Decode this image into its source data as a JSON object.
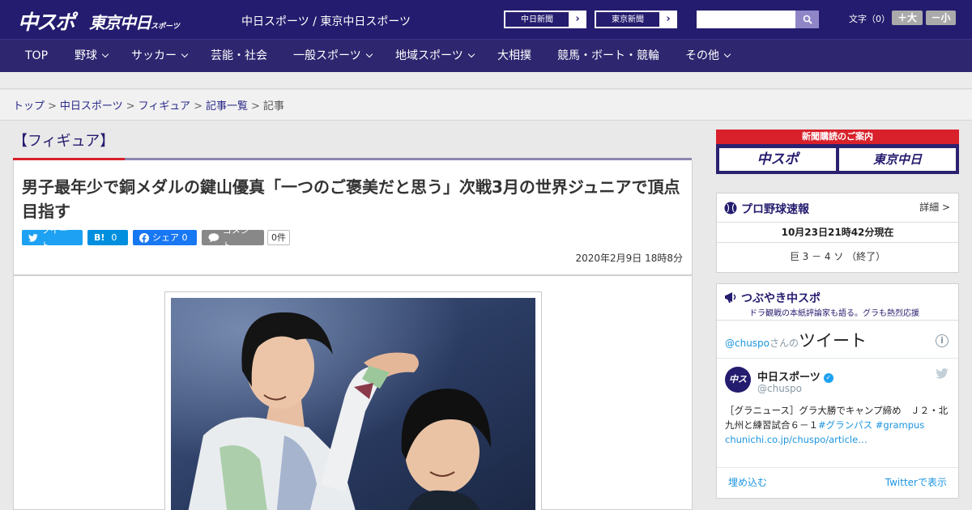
{
  "header": {
    "logo_chuspo": "中スポ",
    "logo_tokyo": "東京中日",
    "logo_tokyo_sub": "スポーツ",
    "site_name": "中日スポーツ / 東京中日スポーツ",
    "ext_links": [
      "中日新聞",
      "東京新聞"
    ],
    "search_placeholder": "",
    "font_size_label": "文字（0）",
    "font_bigger": "＋大",
    "font_smaller": "－小"
  },
  "nav": {
    "items": [
      {
        "label": "TOP",
        "dropdown": false
      },
      {
        "label": "野球",
        "dropdown": true
      },
      {
        "label": "サッカー",
        "dropdown": true
      },
      {
        "label": "芸能・社会",
        "dropdown": false
      },
      {
        "label": "一般スポーツ",
        "dropdown": true
      },
      {
        "label": "地域スポーツ",
        "dropdown": true
      },
      {
        "label": "大相撲",
        "dropdown": false
      },
      {
        "label": "競馬・ボート・競輪",
        "dropdown": false
      },
      {
        "label": "その他",
        "dropdown": true
      }
    ]
  },
  "breadcrumb": {
    "items": [
      "トップ",
      "中日スポーツ",
      "フィギュア",
      "記事一覧"
    ],
    "current": "記事",
    "separator": ">"
  },
  "article": {
    "category": "【フィギュア】",
    "headline": "男子最年少で銅メダルの鍵山優真「一つのご褒美だと思う」次戦3月の世界ジュニアで頂点目指す",
    "share": {
      "twitter": "ツイート",
      "hatena_icon": "B!",
      "hatena_count": "0",
      "facebook": "シェア 0",
      "comment": "コメント",
      "comment_count": "0件"
    },
    "date": "2020年2月9日 18時8分"
  },
  "sidebar": {
    "ad": {
      "title": "新聞購読のご案内",
      "logo1": "中スポ",
      "logo2": "東京中日"
    },
    "baseball": {
      "title": "プロ野球速報",
      "detail": "詳細 >",
      "time": "10月23日21時42分現在",
      "score": "巨 3 － 4 ソ （終了）"
    },
    "tweet_widget": {
      "title": "つぶやき中スポ",
      "subtitle": "ドラ観戦の本紙評論家も語る。グラも熱烈応援",
      "owner_handle": "@chuspo",
      "owner_san": "さんの",
      "owner_tweets": "ツイート",
      "name": "中日スポーツ",
      "handle": "@chuspo",
      "avatar_text": "中スポ",
      "text_main": "［グラニュース］グラ大勝でキャンプ締め　Ｊ２・北九州と練習試合６－１",
      "hashtags": "#グランパス #grampus",
      "link": "chunichi.co.jp/chuspo/article…",
      "embed": "埋め込む",
      "view_on_twitter": "Twitterで表示"
    }
  },
  "colors": {
    "brand_navy": "#241c6e",
    "accent_red": "#d8212b",
    "twitter_blue": "#1da1f2"
  }
}
